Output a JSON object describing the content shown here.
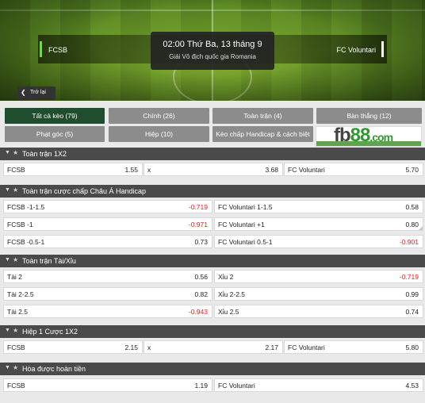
{
  "match": {
    "home": "FCSB",
    "away": "FC Voluntari",
    "time": "02:00 Thứ Ba, 13 tháng 9",
    "league": "Giải Vô địch quốc gia Romania"
  },
  "back": {
    "label": "Trở lại",
    "icon": "chevron-left-icon"
  },
  "tabs": [
    {
      "label": "Tất cả kèo (79)",
      "active": true
    },
    {
      "label": "Chính (26)"
    },
    {
      "label": "Toàn trận (4)"
    },
    {
      "label": "Bàn thắng (12)"
    },
    {
      "label": "Phạt góc (5)"
    },
    {
      "label": "Hiệp (10)"
    },
    {
      "label": "Kèo chấp Handicap & cách biệt (3)"
    }
  ],
  "banner": {
    "fb": "fb",
    "n88": "88",
    "com": ".com",
    "tagline1": "Games To Play",
    "tagline2": "Brilliant Place To Bet"
  },
  "sections": [
    {
      "title": "Toàn trận 1X2",
      "rows": [
        [
          {
            "name": "FCSB",
            "odd": "1.55"
          },
          {
            "name": "x",
            "odd": "3.68"
          },
          {
            "name": "FC Voluntari",
            "odd": "5.70"
          }
        ]
      ]
    },
    {
      "title": "Toàn trận cược chấp Châu Á Handicap",
      "rows": [
        [
          {
            "name": "FCSB -1-1.5",
            "odd": "-0.719"
          },
          {
            "name": "FC Voluntari 1-1.5",
            "odd": "0.58"
          }
        ],
        [
          {
            "name": "FCSB -1",
            "odd": "-0.971"
          },
          {
            "name": "FC Voluntari +1",
            "odd": "0.80"
          }
        ],
        [
          {
            "name": "FCSB -0.5-1",
            "odd": "0.73"
          },
          {
            "name": "FC Voluntari 0.5-1",
            "odd": "-0.901"
          }
        ]
      ]
    },
    {
      "title": "Toàn trận Tài/Xỉu",
      "rows": [
        [
          {
            "name": "Tài 2",
            "odd": "0.56"
          },
          {
            "name": "Xỉu 2",
            "odd": "-0.719"
          }
        ],
        [
          {
            "name": "Tài 2-2.5",
            "odd": "0.82"
          },
          {
            "name": "Xỉu 2-2.5",
            "odd": "0.99"
          }
        ],
        [
          {
            "name": "Tài 2.5",
            "odd": "-0.943"
          },
          {
            "name": "Xỉu 2.5",
            "odd": "0.74"
          }
        ]
      ]
    },
    {
      "title": "Hiệp 1 Cược 1X2",
      "rows": [
        [
          {
            "name": "FCSB",
            "odd": "2.15"
          },
          {
            "name": "x",
            "odd": "2.17"
          },
          {
            "name": "FC Voluntari",
            "odd": "5.80"
          }
        ]
      ]
    },
    {
      "title": "Hòa được hoàn tiền",
      "rows": [
        [
          {
            "name": "FCSB",
            "odd": "1.19"
          },
          {
            "name": "FC Voluntari",
            "odd": "4.53"
          }
        ]
      ]
    }
  ],
  "colors": {
    "active_tab": "#1f4d2e",
    "tab": "#8c8c8c",
    "section_header": "#4a4a4a",
    "negative_odd": "#e02020"
  }
}
